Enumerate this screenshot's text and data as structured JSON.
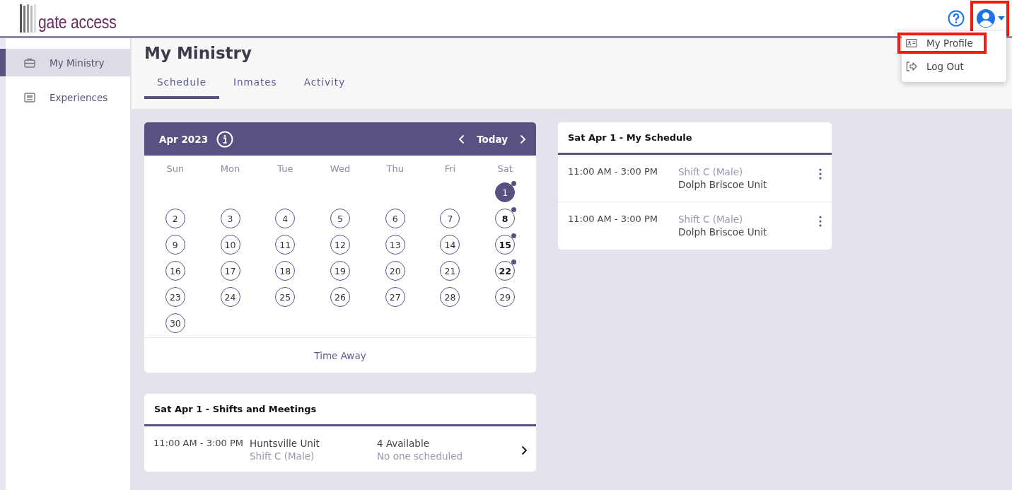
{
  "header": {
    "logo_text": "gate access",
    "user_button": {
      "highlighted": true
    }
  },
  "user_menu": {
    "items": [
      {
        "label": "My Profile",
        "highlighted": true
      },
      {
        "label": "Log Out",
        "highlighted": false
      }
    ]
  },
  "sidebar": {
    "items": [
      {
        "label": "My Ministry",
        "selected": true
      },
      {
        "label": "Experiences",
        "selected": false
      }
    ]
  },
  "page": {
    "title": "My Ministry",
    "tabs": [
      {
        "label": "Schedule",
        "selected": true
      },
      {
        "label": "Inmates",
        "selected": false
      },
      {
        "label": "Activity",
        "selected": false
      }
    ]
  },
  "calendar": {
    "month": "Apr 2023",
    "today": "Today",
    "weekdays": [
      "Sun",
      "Mon",
      "Tue",
      "Wed",
      "Thu",
      "Fri",
      "Sat"
    ],
    "weeks": [
      [
        {
          "label": "1",
          "selected": true,
          "has_event": true
        }
      ],
      [
        {
          "label": "2",
          "selected": false,
          "has_event": false
        },
        {
          "label": "3",
          "selected": false,
          "has_event": false
        },
        {
          "label": "4",
          "selected": false,
          "has_event": false
        },
        {
          "label": "5",
          "selected": false,
          "has_event": false
        },
        {
          "label": "6",
          "selected": false,
          "has_event": false
        },
        {
          "label": "7",
          "selected": false,
          "has_event": false
        },
        {
          "label": "8",
          "selected": false,
          "has_event": true
        }
      ],
      [
        {
          "label": "9",
          "selected": false,
          "has_event": false
        },
        {
          "label": "10",
          "selected": false,
          "has_event": false
        },
        {
          "label": "11",
          "selected": false,
          "has_event": false
        },
        {
          "label": "12",
          "selected": false,
          "has_event": false
        },
        {
          "label": "13",
          "selected": false,
          "has_event": false
        },
        {
          "label": "14",
          "selected": false,
          "has_event": false
        },
        {
          "label": "15",
          "selected": false,
          "has_event": true
        }
      ],
      [
        {
          "label": "16",
          "selected": false,
          "has_event": false
        },
        {
          "label": "17",
          "selected": false,
          "has_event": false
        },
        {
          "label": "18",
          "selected": false,
          "has_event": false
        },
        {
          "label": "19",
          "selected": false,
          "has_event": false
        },
        {
          "label": "20",
          "selected": false,
          "has_event": false
        },
        {
          "label": "21",
          "selected": false,
          "has_event": false
        },
        {
          "label": "22",
          "selected": false,
          "has_event": true
        }
      ],
      [
        {
          "label": "23",
          "selected": false,
          "has_event": false
        },
        {
          "label": "24",
          "selected": false,
          "has_event": false
        },
        {
          "label": "25",
          "selected": false,
          "has_event": false
        },
        {
          "label": "26",
          "selected": false,
          "has_event": false
        },
        {
          "label": "27",
          "selected": false,
          "has_event": false
        },
        {
          "label": "28",
          "selected": false,
          "has_event": false
        },
        {
          "label": "29",
          "selected": false,
          "has_event": false
        }
      ],
      [
        {
          "label": "30",
          "selected": false,
          "has_event": false
        }
      ]
    ],
    "footer_link": "Time Away"
  },
  "my_schedule": {
    "title": "Sat Apr 1 - My Schedule",
    "items": [
      {
        "time": "11:00 AM - 3:00 PM",
        "shift": "Shift C (Male)",
        "unit": "Dolph Briscoe Unit"
      },
      {
        "time": "11:00 AM - 3:00 PM",
        "shift": "Shift C (Male)",
        "unit": "Dolph Briscoe Unit"
      }
    ]
  },
  "shifts": {
    "title": "Sat Apr 1 - Shifts and Meetings",
    "rows": [
      {
        "time": "11:00 AM - 3:00 PM",
        "unit": "Huntsville Unit",
        "shift": "Shift C (Male)",
        "availability": "4 Available",
        "scheduled": "No one scheduled"
      }
    ]
  }
}
